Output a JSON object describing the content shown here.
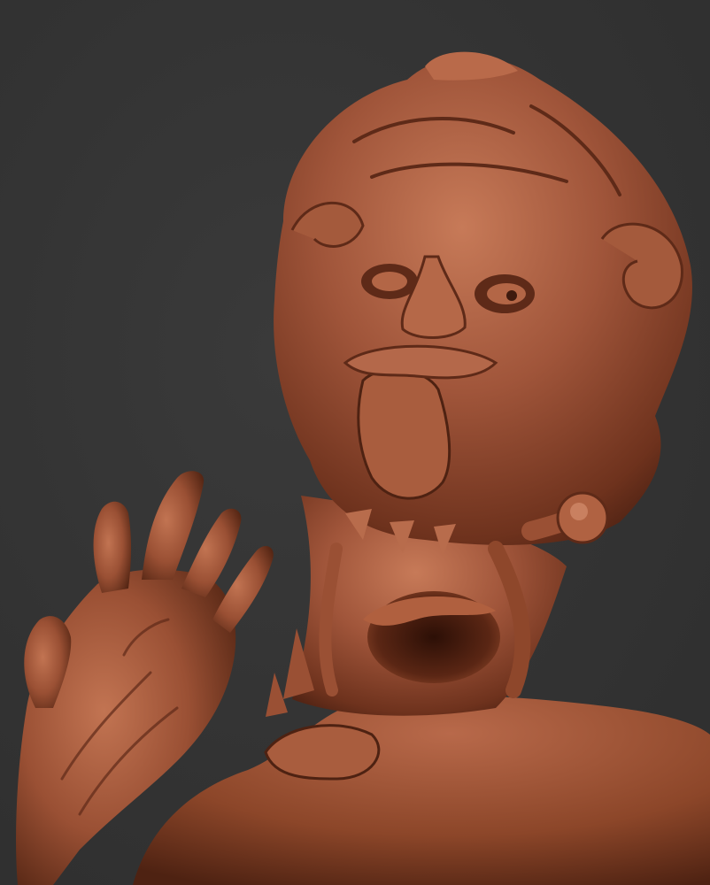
{
  "scene": {
    "subject": "clay-sculpt-render",
    "colors": {
      "background": "#333333",
      "clay_base": "#a0553a",
      "clay_light": "#c77a58",
      "clay_shadow": "#5e2a18",
      "clay_deep": "#3e1a0e"
    }
  }
}
